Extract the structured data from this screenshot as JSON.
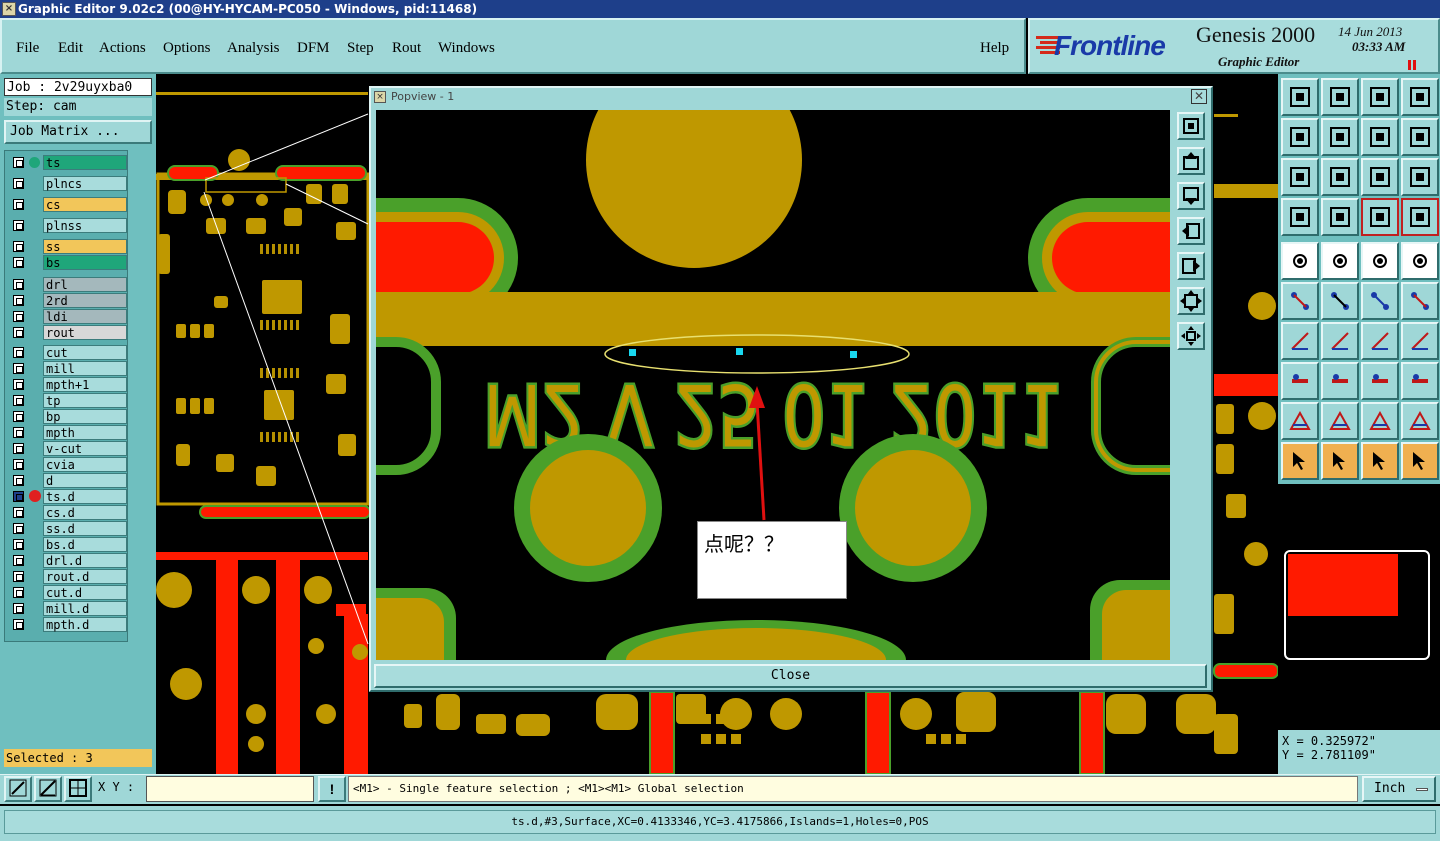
{
  "window": {
    "title": "Graphic Editor 9.02c2 (00@HY-HYCAM-PC050 - Windows, pid:11468)"
  },
  "menu": {
    "items": [
      "File",
      "Edit",
      "Actions",
      "Options",
      "Analysis",
      "DFM",
      "Step",
      "Rout",
      "Windows"
    ],
    "help": "Help"
  },
  "brand": {
    "logo": "Frontline",
    "product": "Genesis 2000",
    "subtitle": "Graphic Editor",
    "date": "14 Jun 2013",
    "time": "03:33 AM"
  },
  "job": {
    "label": "Job : 2v29uyxba0",
    "step": "Step: cam",
    "matrix_button": "Job Matrix ..."
  },
  "layers": [
    {
      "name": "ts",
      "color": "#1fa67a"
    },
    {
      "name": "plncs",
      "color": "#a8dcdc"
    },
    {
      "name": "cs",
      "color": "#f2c65a"
    },
    {
      "name": "plnss",
      "color": "#a8dcdc"
    },
    {
      "name": "ss",
      "color": "#f2c65a"
    },
    {
      "name": "bs",
      "color": "#1fa67a"
    },
    {
      "name": "drl",
      "color": "#a4b8bc"
    },
    {
      "name": "2rd",
      "color": "#a4b8bc"
    },
    {
      "name": "ldi",
      "color": "#a4b8bc"
    },
    {
      "name": "rout",
      "color": "#d8d8d8"
    },
    {
      "name": "cut",
      "color": "#a8dcdc"
    },
    {
      "name": "mill",
      "color": "#a8dcdc"
    },
    {
      "name": "mpth+1",
      "color": "#a8dcdc"
    },
    {
      "name": "tp",
      "color": "#a8dcdc"
    },
    {
      "name": "bp",
      "color": "#a8dcdc"
    },
    {
      "name": "mpth",
      "color": "#a8dcdc"
    },
    {
      "name": "v-cut",
      "color": "#a8dcdc"
    },
    {
      "name": "cvia",
      "color": "#a8dcdc"
    },
    {
      "name": "d",
      "color": "#a8dcdc"
    },
    {
      "name": "ts.d",
      "color": "#a8dcdc"
    },
    {
      "name": "cs.d",
      "color": "#a8dcdc"
    },
    {
      "name": "ss.d",
      "color": "#a8dcdc"
    },
    {
      "name": "bs.d",
      "color": "#a8dcdc"
    },
    {
      "name": "drl.d",
      "color": "#a8dcdc"
    },
    {
      "name": "rout.d",
      "color": "#a8dcdc"
    },
    {
      "name": "cut.d",
      "color": "#a8dcdc"
    },
    {
      "name": "mill.d",
      "color": "#a8dcdc"
    },
    {
      "name": "mpth.d",
      "color": "#a8dcdc"
    }
  ],
  "selected": "Selected : 3",
  "popview": {
    "title": "Popview - 1",
    "close": "Close",
    "silkscreen_text": "M2 V 25 01 2011",
    "annotation": "点呢？？"
  },
  "coords": {
    "x": "X = 0.325972\"",
    "y": "Y = 2.781109\""
  },
  "bottom": {
    "xy_label": "X Y :",
    "xy_value": "",
    "hint": "<M1> - Single feature selection ; <M1><M1> Global selection",
    "units": "Inch"
  },
  "status": "ts.d,#3,Surface,XC=0.4133346,YC=3.4175866,Islands=1,Holes=0,POS",
  "colors": {
    "copper": "#bf9800",
    "mask_green": "#4aa02a",
    "pad_red": "#ff1a00",
    "panel": "#9fd7d7",
    "title_blue": "#1e3f8a"
  }
}
